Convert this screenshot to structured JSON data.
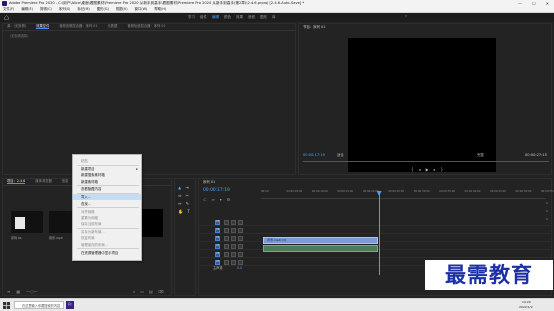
{
  "window": {
    "title": "Adobe Premiere Pro 2020 - C:\\用户\\Alice\\桌面\\看图素材\\Premiere Pro 2020 从新手到高手\\看图素材\\Premiere Pro 2020 从新手到高手(第2章)\\2.4.6.prproj [2.4.6-Auto-Save] *",
    "minimize": "—",
    "maximize": "☐",
    "close": "✕"
  },
  "menu": [
    "文件(F)",
    "编辑(E)",
    "剪辑(C)",
    "序列(S)",
    "标记(M)",
    "图形(G)",
    "视图(V)",
    "窗口(W)",
    "帮助(H)"
  ],
  "workspaces": {
    "tabs": [
      "学习",
      "组件",
      "编辑",
      "颜色",
      "效果",
      "音频",
      "图形",
      "库"
    ],
    "active_index": 2,
    "more": "»"
  },
  "source_panel": {
    "tabs": [
      "源：(无剪辑)",
      "效果控件",
      "音频剪辑混合器：序列 01",
      "元数据",
      "音频轨道混合器：序列 01"
    ],
    "active_index": 1,
    "subtitle": "（无剪辑选择）"
  },
  "program_panel": {
    "title": "节目：序列 01",
    "timecode": "00:00:17:19",
    "fit": "适合",
    "quality": "完整",
    "duration": "00:00:27:15"
  },
  "project_panel": {
    "tabs": [
      "项目：2.4.6",
      "媒体浏览器",
      "信息",
      "效果",
      "标记"
    ],
    "active_index": 0,
    "bins": [
      "序列 01",
      "音乐.mp3"
    ]
  },
  "timeline": {
    "title": "序列 01",
    "timecode": "00:00:17:19",
    "ruler": [
      "00:00",
      "00:00:05:00",
      "00:00:10:00",
      "00:00:15:00",
      "00:00:20:00",
      "00:00:25:00",
      "00:00:30:00",
      "00:00:35:00",
      "00:00:40:00",
      "00:00:45:00",
      "00:00:50:00",
      "00:00:55:00"
    ],
    "tracks": [
      "V3",
      "V2",
      "V1",
      "A1",
      "A2",
      "A3"
    ],
    "master": "主声道",
    "master_value": "0.0",
    "clip_label": "背景.mp4 [V]",
    "playhead_fraction": 0.42
  },
  "context_menu": {
    "items": [
      {
        "label": "粘贴",
        "enabled": false
      },
      {
        "label": "新建项目",
        "enabled": true,
        "arrow": true
      },
      {
        "label": "新建搜索素材箱",
        "enabled": true
      },
      {
        "label": "新建素材箱",
        "enabled": true
      },
      {
        "label": "查看隐藏内容",
        "enabled": true
      },
      {
        "label": "导入...",
        "enabled": true,
        "highlighted": true
      },
      {
        "label": "查找...",
        "enabled": true
      },
      {
        "label": "对齐网格",
        "enabled": false
      },
      {
        "label": "重置为网格",
        "enabled": false
      },
      {
        "label": "保存当前布局",
        "enabled": false
      },
      {
        "label": "另存为新布局...",
        "enabled": false
      },
      {
        "label": "恢复布局",
        "enabled": false
      },
      {
        "label": "管理保存的布局...",
        "enabled": false
      },
      {
        "label": "在资源管理器中显示项目",
        "enabled": true
      }
    ]
  },
  "taskbar": {
    "search_placeholder": "在这里输入你要搜索的内容",
    "time": "14:29",
    "date": "2022/1/9"
  },
  "watermark": "最需教育",
  "colors": {
    "accent": "#4da2ff",
    "panel_bg": "#232323",
    "menu_bg": "#f0f0f0",
    "watermark": "#1b2fa6"
  }
}
